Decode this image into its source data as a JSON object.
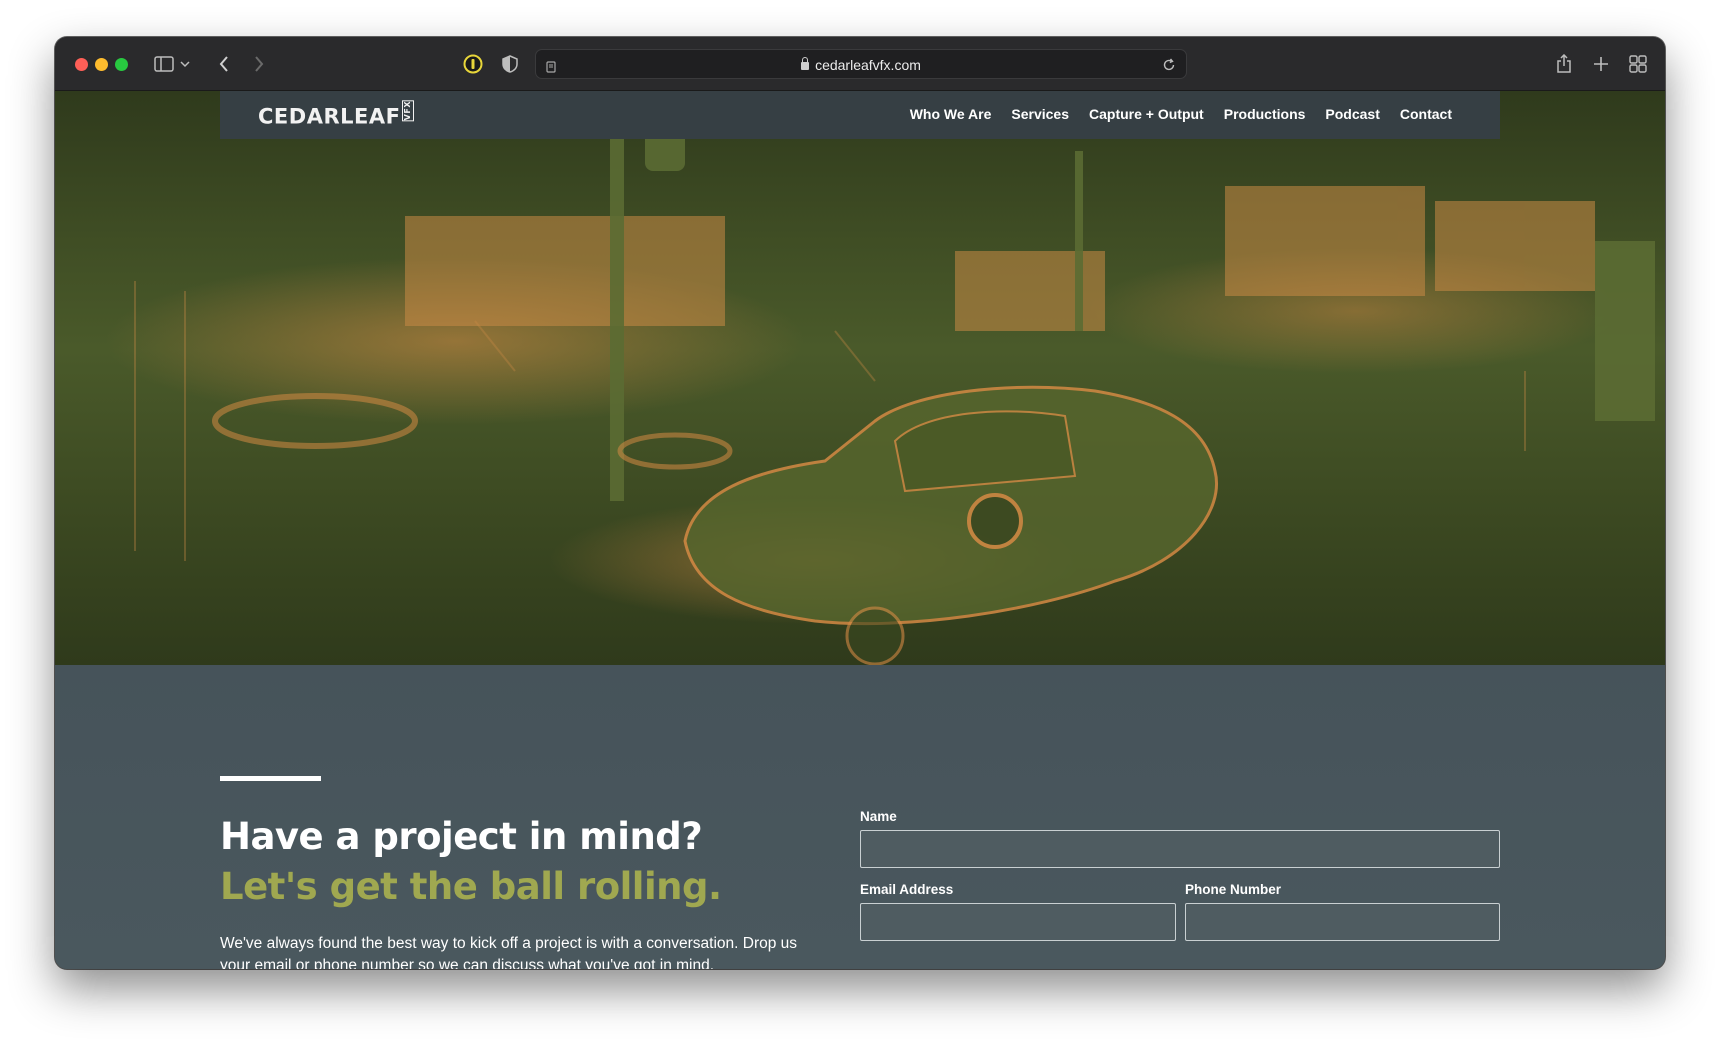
{
  "browser": {
    "url": "cedarleafvfx.com"
  },
  "site": {
    "logo_text": "CEDARLEAF",
    "logo_badge": "VFX",
    "nav": [
      "Who We Are",
      "Services",
      "Capture + Output",
      "Productions",
      "Podcast",
      "Contact"
    ]
  },
  "contact": {
    "heading": "Have a project in mind?",
    "subheading": "Let's get the ball rolling.",
    "blurb": "We've always found the best way to kick off a project is with a conversation. Drop us your email or phone number so we can discuss what you've got in mind.",
    "form": {
      "name_label": "Name",
      "email_label": "Email Address",
      "phone_label": "Phone Number"
    }
  },
  "colors": {
    "accent_green": "#a0a850",
    "hero_orange": "#d48a44",
    "section_bg": "#47555a"
  }
}
